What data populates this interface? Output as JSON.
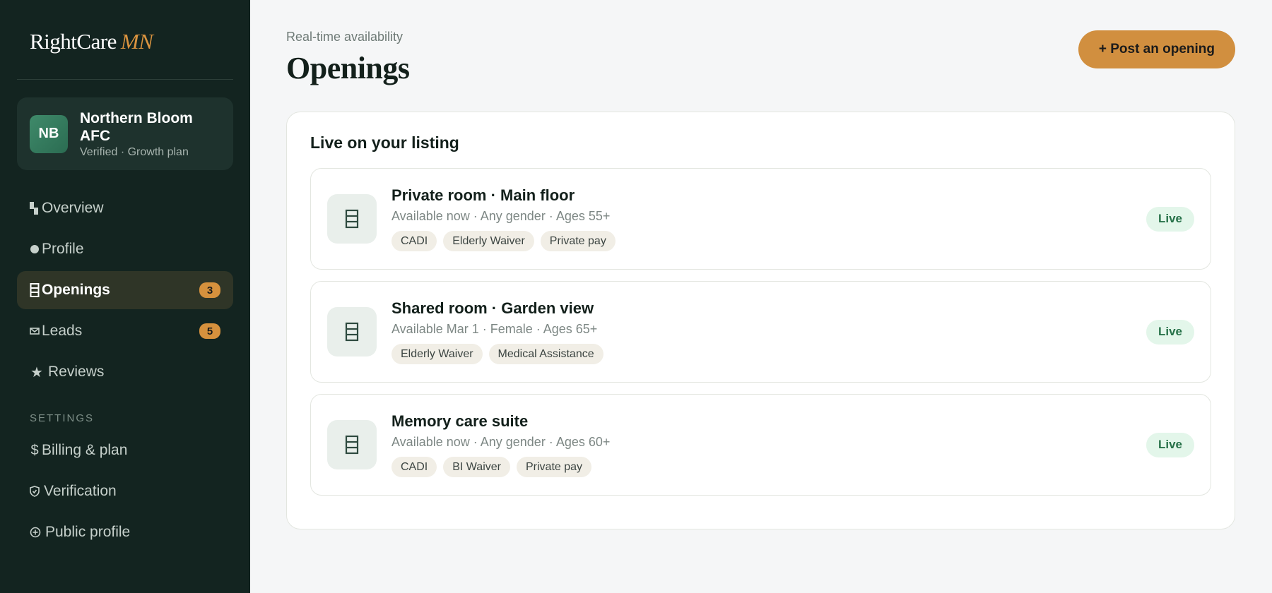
{
  "brand": {
    "name": "RightCare",
    "accent": "MN"
  },
  "org": {
    "initials": "NB",
    "name": "Northern Bloom AFC",
    "subtitle": "Verified · Growth plan"
  },
  "nav": {
    "items": [
      {
        "label": "Overview",
        "icon": "chart-icon"
      },
      {
        "label": "Profile",
        "icon": "profile-icon"
      },
      {
        "label": "Openings",
        "icon": "building-icon",
        "badge": "3",
        "active": true
      },
      {
        "label": "Leads",
        "icon": "mail-icon",
        "badge": "5"
      },
      {
        "label": "Reviews",
        "icon": "star-icon"
      }
    ],
    "settings_label": "SETTINGS",
    "settings_items": [
      {
        "label": "Billing & plan",
        "icon": "dollar-icon"
      },
      {
        "label": "Verification",
        "icon": "shield-icon"
      },
      {
        "label": "Public profile",
        "icon": "globe-icon"
      }
    ]
  },
  "header": {
    "eyebrow": "Real-time availability",
    "title": "Openings",
    "post_button": "+ Post an opening"
  },
  "panel": {
    "title": "Live on your listing",
    "openings": [
      {
        "title": "Private room · Main floor",
        "meta": "Available now · Any gender · Ages 55+",
        "tags": [
          "CADI",
          "Elderly Waiver",
          "Private pay"
        ],
        "status": "Live"
      },
      {
        "title": "Shared room · Garden view",
        "meta": "Available Mar 1 · Female · Ages 65+",
        "tags": [
          "Elderly Waiver",
          "Medical Assistance"
        ],
        "status": "Live"
      },
      {
        "title": "Memory care suite",
        "meta": "Available now · Any gender · Ages 60+",
        "tags": [
          "CADI",
          "BI Waiver",
          "Private pay"
        ],
        "status": "Live"
      }
    ]
  },
  "colors": {
    "sidebar_bg": "#132420",
    "accent": "#d18f3f",
    "live_bg": "#e3f6ea",
    "live_text": "#267148"
  }
}
